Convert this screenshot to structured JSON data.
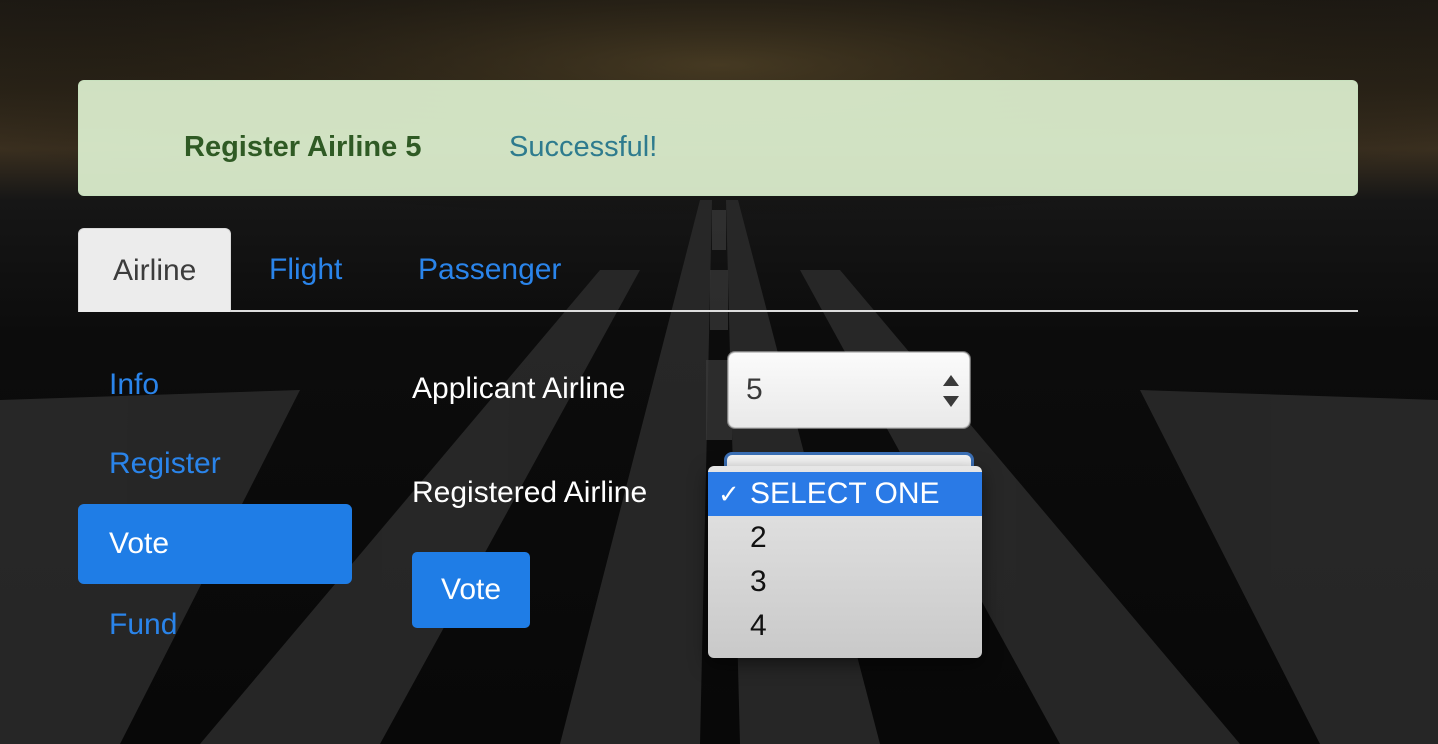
{
  "alert": {
    "title": "Register Airline 5",
    "message": "Successful!"
  },
  "tabs": [
    {
      "label": "Airline",
      "active": true
    },
    {
      "label": "Flight",
      "active": false
    },
    {
      "label": "Passenger",
      "active": false
    }
  ],
  "sidebar": {
    "items": [
      {
        "label": "Info",
        "active": false
      },
      {
        "label": "Register",
        "active": false
      },
      {
        "label": "Vote",
        "active": true
      },
      {
        "label": "Fund",
        "active": false
      }
    ]
  },
  "form": {
    "applicant_label": "Applicant Airline",
    "applicant_value": "5",
    "registered_label": "Registered Airline",
    "registered_options": [
      "SELECT ONE",
      "2",
      "3",
      "4"
    ],
    "registered_selected": "SELECT ONE",
    "vote_button": "Vote"
  },
  "colors": {
    "primary": "#1f7de6",
    "alert_bg": "#def0d0",
    "alert_title": "#2f5a24",
    "alert_msg": "#2e7b8e"
  }
}
